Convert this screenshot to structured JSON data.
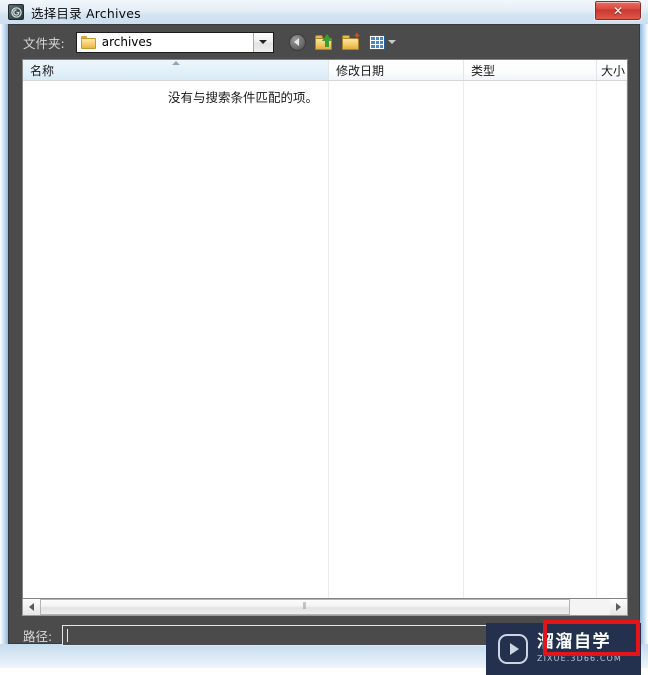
{
  "window": {
    "title": "选择目录 Archives",
    "icon": "app-logo-icon",
    "close_label": "✕"
  },
  "folder_bar": {
    "label": "文件夹:",
    "combo_value": "archives",
    "combo_icon": "folder-icon",
    "dropdown_icon": "chevron-down-icon",
    "toolbar": [
      {
        "name": "back-icon",
        "title": "后退"
      },
      {
        "name": "up-folder-icon",
        "title": "向上一级"
      },
      {
        "name": "new-folder-icon",
        "title": "新建文件夹"
      },
      {
        "name": "views-icon",
        "title": "视图"
      }
    ]
  },
  "file_list": {
    "columns": [
      {
        "label": "名称",
        "sorted": true,
        "sort_icon": "sort-ascending-icon"
      },
      {
        "label": "修改日期",
        "sorted": false
      },
      {
        "label": "类型",
        "sorted": false
      },
      {
        "label": "大小",
        "sorted": false
      }
    ],
    "empty_message": "没有与搜索条件匹配的项。",
    "rows": []
  },
  "scrollbar": {
    "left_icon": "triangle-left-icon",
    "right_icon": "triangle-right-icon",
    "grip_glyph": "⦀"
  },
  "path_bar": {
    "label": "路径:",
    "value": "",
    "placeholder": ""
  },
  "watermark": {
    "logo_icon": "play-button-icon",
    "title": "溜溜自学",
    "subtitle": "ZIXUE.3D66.COM"
  },
  "annotation": {
    "type": "red-rectangle-highlight",
    "color": "#e5131a"
  },
  "colors": {
    "dialog_bg": "#4b4b4b",
    "titlebar": "#dfeaf5",
    "close_red": "#d94b40",
    "watermark_bg": "#23314f",
    "annotation_red": "#e5131a"
  }
}
